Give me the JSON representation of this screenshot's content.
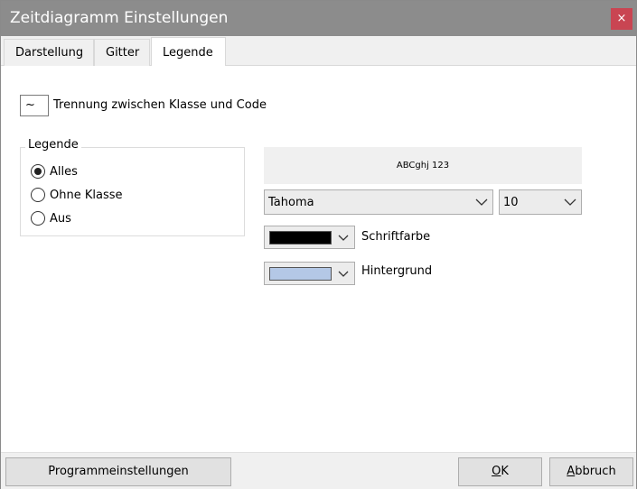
{
  "window": {
    "title": "Zeitdiagramm Einstellungen",
    "close_glyph": "×"
  },
  "tabs": [
    {
      "label": "Darstellung",
      "active": false
    },
    {
      "label": "Gitter",
      "active": false
    },
    {
      "label": "Legende",
      "active": true
    }
  ],
  "separator": {
    "value": "~",
    "label": "Trennung zwischen Klasse und Code"
  },
  "legend_group": {
    "title": "Legende",
    "options": [
      {
        "label": "Alles",
        "checked": true
      },
      {
        "label": "Ohne Klasse",
        "checked": false
      },
      {
        "label": "Aus",
        "checked": false
      }
    ]
  },
  "font": {
    "preview_text": "ABCghj 123",
    "family": "Tahoma",
    "size": "10"
  },
  "colors": {
    "text": {
      "label": "Schriftfarbe",
      "color": "#000000"
    },
    "background": {
      "label": "Hintergrund",
      "color": "#b4c8e6"
    }
  },
  "footer": {
    "program_settings": "Programmeinstellungen",
    "ok_access": "O",
    "ok_rest": "K",
    "cancel_access": "A",
    "cancel_rest": "bbruch"
  },
  "theme": {
    "titlebar": "#8c8c8c",
    "close": "#c94552"
  }
}
